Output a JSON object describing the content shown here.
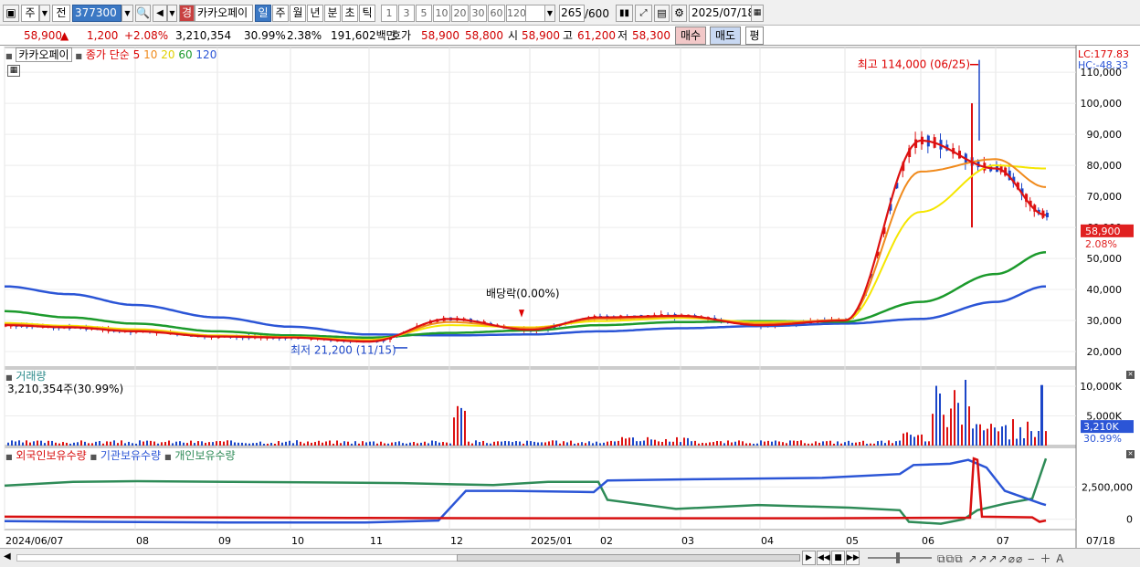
{
  "toolbar": {
    "market": "주",
    "prev": "전",
    "code": "377300",
    "stock_name": "카카오페이",
    "type_badge": "경",
    "periods": [
      "일",
      "주",
      "월",
      "년",
      "분",
      "초",
      "틱"
    ],
    "intervals": [
      "1",
      "3",
      "5",
      "10",
      "20",
      "30",
      "60",
      "120"
    ],
    "count": "265",
    "count_max": "/600",
    "date": "2025/07/18"
  },
  "quote": {
    "price": "58,900",
    "change_arrow": "▲",
    "change": "1,200",
    "change_pct": "+2.08%",
    "volume": "3,210,354",
    "vol_ratio": "30.99%",
    "turnover": "2.38%",
    "amount": "191,602백만",
    "ask_label": "호가",
    "ask": "58,900",
    "bid": "58,800",
    "open_label": "시",
    "open": "58,900",
    "high_label": "고",
    "high": "61,200",
    "low_label": "저",
    "low": "58,300",
    "buy": "매수",
    "sell": "매도",
    "flat": "평"
  },
  "price_pane": {
    "stock": "카카오페이",
    "ma_label": "종가 단순",
    "ma_periods": [
      "5",
      "10",
      "20",
      "60",
      "120"
    ],
    "lc": "LC:177.83",
    "hc": "HC:-48.33",
    "high_annotation": "최고 114,000 (06/25)",
    "low_annotation": "최저 21,200 (11/15)",
    "dividend_annotation": "배당락(0.00%)",
    "y_labels": [
      "110,000",
      "100,000",
      "90,000",
      "80,000",
      "70,000",
      "60,000",
      "50,000",
      "40,000",
      "30,000",
      "20,000"
    ],
    "current_price": "58,900",
    "current_pct": "2.08%"
  },
  "volume_pane": {
    "title": "거래량",
    "value": "3,210,354주(30.99%)",
    "y_labels": [
      "10,000K",
      "5,000K"
    ],
    "current": "3,210K",
    "current_pct": "30.99%"
  },
  "holdings_pane": {
    "series": [
      "외국인보유수량",
      "기관보유수량",
      "개인보유수량"
    ],
    "y_labels": [
      "2,500,000",
      "0"
    ]
  },
  "x_axis": [
    "2024/06/07",
    "08",
    "09",
    "10",
    "11",
    "12",
    "2025/01",
    "02",
    "03",
    "04",
    "05",
    "06",
    "07",
    "07/18"
  ],
  "colors": {
    "ma5": "#dd1111",
    "ma10": "#f08a1c",
    "ma20": "#f5e600",
    "ma60": "#1c9a2c",
    "ma120": "#2b55d6",
    "up": "#dd1111",
    "down": "#1c46c8",
    "foreign": "#d81010",
    "inst": "#2b55d6",
    "indiv": "#2e8b57"
  },
  "chart_data": [
    {
      "type": "line",
      "title": "카카오페이",
      "x": [
        "2024/06/07",
        "07",
        "08",
        "09",
        "10",
        "11",
        "12",
        "2025/01",
        "02",
        "03",
        "04",
        "05",
        "06",
        "07",
        "07/18"
      ],
      "series": [
        {
          "name": "5",
          "values": [
            28500,
            27800,
            26500,
            24800,
            24500,
            23200,
            30500,
            27000,
            31000,
            31500,
            28500,
            30000,
            88000,
            79000,
            64000
          ]
        },
        {
          "name": "10",
          "values": [
            28800,
            28000,
            26800,
            25000,
            24600,
            23500,
            29500,
            27500,
            30500,
            31200,
            29000,
            30200,
            78000,
            82000,
            73000
          ]
        },
        {
          "name": "20",
          "values": [
            29200,
            28300,
            27200,
            25200,
            24700,
            23800,
            28500,
            27800,
            29800,
            30800,
            29500,
            30000,
            65000,
            80000,
            79000
          ]
        },
        {
          "name": "60",
          "values": [
            33000,
            31000,
            29000,
            26500,
            25200,
            24500,
            26000,
            26800,
            28500,
            29500,
            29800,
            29600,
            36000,
            45000,
            52000
          ]
        },
        {
          "name": "120",
          "values": [
            41000,
            38500,
            35000,
            31000,
            28000,
            25500,
            25200,
            25500,
            26500,
            27500,
            28200,
            29000,
            30500,
            36000,
            41000
          ]
        }
      ],
      "high": 114000,
      "low": 21200,
      "ylim": [
        15000,
        118000
      ]
    },
    {
      "type": "bar",
      "title": "거래량",
      "ylim": [
        0,
        12000000
      ]
    },
    {
      "type": "line",
      "series": [
        {
          "name": "외국인보유수량"
        },
        {
          "name": "기관보유수량"
        },
        {
          "name": "개인보유수량"
        }
      ]
    }
  ]
}
